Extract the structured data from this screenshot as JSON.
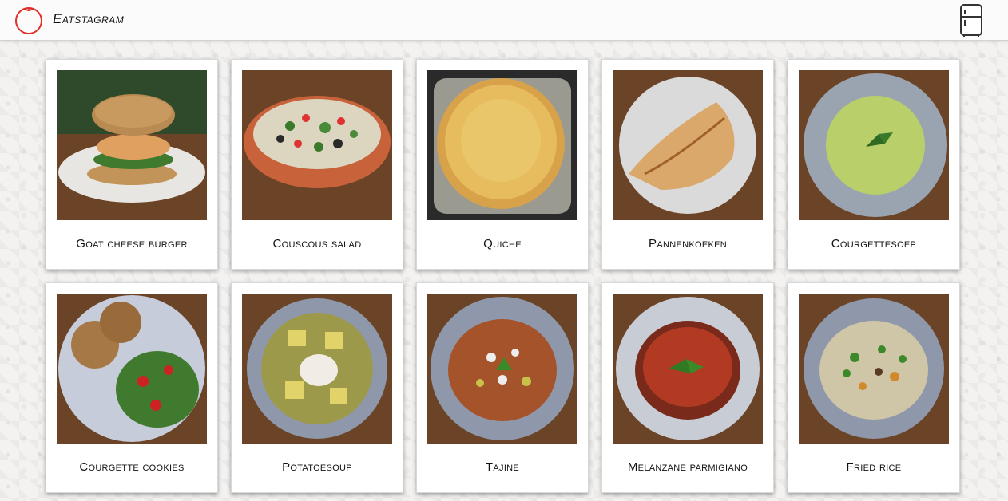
{
  "app": {
    "title": "Eatstagram"
  },
  "icons": {
    "logo": "tomato-logo-icon",
    "fridge": "fridge-icon"
  },
  "colors": {
    "logo": "#e0302a",
    "card": "#ffffff",
    "wood": "#6b4428"
  },
  "recipes": [
    {
      "name": "Goat cheese burger"
    },
    {
      "name": "Couscous salad"
    },
    {
      "name": "Quiche"
    },
    {
      "name": "Pannenkoeken"
    },
    {
      "name": "Courgettesoep"
    },
    {
      "name": "Courgette cookies"
    },
    {
      "name": "Potatoesoup"
    },
    {
      "name": "Tajine"
    },
    {
      "name": "Melanzane parmigiano"
    },
    {
      "name": "Fried rice"
    }
  ]
}
